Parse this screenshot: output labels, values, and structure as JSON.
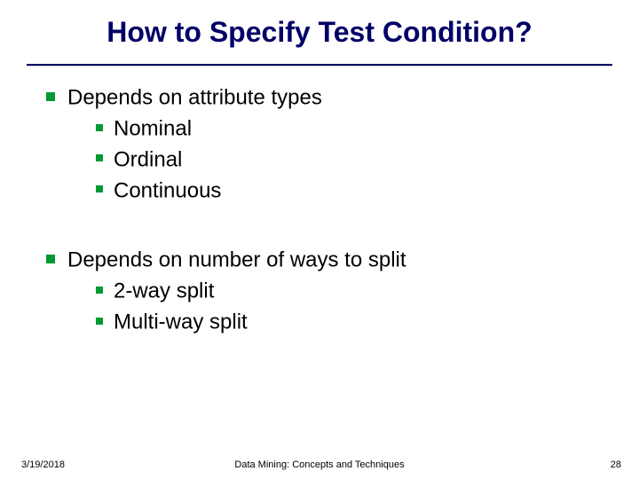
{
  "title": "How to Specify Test Condition?",
  "body": {
    "group1": {
      "heading": "Depends on attribute types",
      "items": [
        "Nominal",
        "Ordinal",
        "Continuous"
      ]
    },
    "group2": {
      "heading": "Depends on number of ways to split",
      "items": [
        "2-way split",
        "Multi-way split"
      ]
    }
  },
  "footer": {
    "date": "3/19/2018",
    "center": "Data Mining: Concepts and Techniques",
    "page": "28"
  }
}
